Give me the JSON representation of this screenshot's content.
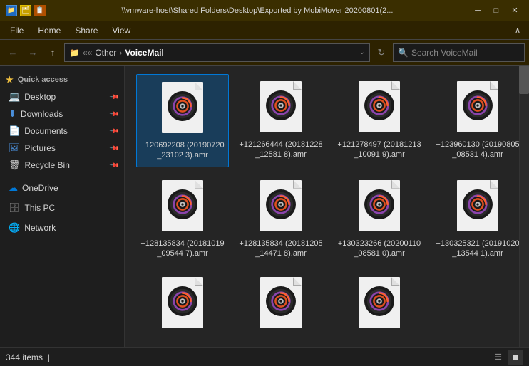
{
  "titleBar": {
    "path": "\\\\vmware-host\\Shared Folders\\Desktop\\Exported by MobiMover 20200801(2...",
    "minimizeLabel": "─",
    "maximizeLabel": "□",
    "closeLabel": "✕"
  },
  "menuBar": {
    "items": [
      "File",
      "Home",
      "Share",
      "View"
    ],
    "expandLabel": "∧"
  },
  "addressBar": {
    "backLabel": "←",
    "forwardLabel": "→",
    "upLabel": "↑",
    "pathParts": [
      "Other",
      "VoiceMail"
    ],
    "searchPlaceholder": "Search VoiceMail",
    "refreshLabel": "↻"
  },
  "sidebar": {
    "quickAccess": {
      "label": "Quick access",
      "icon": "★"
    },
    "items": [
      {
        "label": "Desktop",
        "icon": "🖥",
        "pinned": true
      },
      {
        "label": "Downloads",
        "icon": "📥",
        "pinned": true
      },
      {
        "label": "Documents",
        "icon": "📄",
        "pinned": true
      },
      {
        "label": "Pictures",
        "icon": "🖼",
        "pinned": true
      },
      {
        "label": "Recycle Bin",
        "icon": "🗑",
        "pinned": true
      }
    ],
    "sections": [
      {
        "label": "OneDrive",
        "icon": "☁"
      },
      {
        "label": "This PC",
        "icon": "💻"
      },
      {
        "label": "Network",
        "icon": "🌐"
      }
    ]
  },
  "files": [
    {
      "name": "+120692208\n(20190720_23102\n3).amr",
      "selected": true
    },
    {
      "name": "+121266444\n(20181228_12581\n8).amr",
      "selected": false
    },
    {
      "name": "+121278497\n(20181213_10091\n9).amr",
      "selected": false
    },
    {
      "name": "+123960130\n(20190805_08531\n4).amr",
      "selected": false
    },
    {
      "name": "+128135834\n(20181019_09544\n7).amr",
      "selected": false
    },
    {
      "name": "+128135834\n(20181205_14471\n8).amr",
      "selected": false
    },
    {
      "name": "+130323266\n(20200110_08581\n0).amr",
      "selected": false
    },
    {
      "name": "+130325321\n(20191020_13544\n1).amr",
      "selected": false
    },
    {
      "name": "",
      "selected": false,
      "partial": true
    },
    {
      "name": "",
      "selected": false,
      "partial": true
    },
    {
      "name": "",
      "selected": false,
      "partial": true
    }
  ],
  "statusBar": {
    "count": "344 items",
    "separator": "|"
  },
  "vinylColors": {
    "outer": "#1a1a1a",
    "ring1": "#8B44AC",
    "ring2": "#E05020",
    "ring3": "#c8c8c8",
    "center": "#1a1a1a",
    "highlight": "#ff6030"
  }
}
